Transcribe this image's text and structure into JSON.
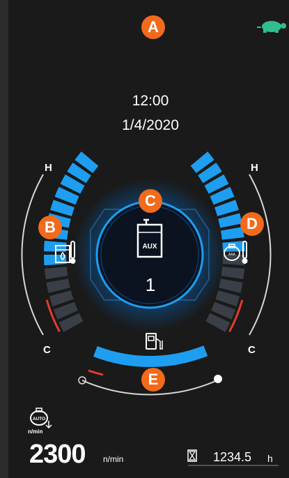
{
  "clock": {
    "time": "12:00",
    "date": "1/4/2020"
  },
  "badges": {
    "a": "A",
    "b": "B",
    "c": "C",
    "d": "D",
    "e": "E"
  },
  "left_gauge": {
    "hot_label": "H",
    "cold_label": "C",
    "level": 0.62,
    "icon": "coolant-temperature-icon"
  },
  "right_gauge": {
    "hot_label": "H",
    "cold_label": "C",
    "level": 0.6,
    "icon": "hydraulic-oil-temperature-icon"
  },
  "center": {
    "mode_label": "AUX",
    "mode_value": "1",
    "icon": "aux-tank-icon"
  },
  "fuel": {
    "level": 0.9,
    "icon": "fuel-pump-icon"
  },
  "engine_speed": {
    "icon_label": "AUTO",
    "icon_unit": "n/min",
    "value": "2300",
    "unit": "n/min"
  },
  "hour_meter": {
    "value": "1234.5",
    "unit": "h",
    "icon": "hourglass-icon"
  },
  "status": {
    "icon": "turtle-mode-icon"
  },
  "colors": {
    "accent": "#1e9ef0",
    "badge": "#f26a1b",
    "hot": "#e23c2c",
    "turtle": "#2fbf8c"
  }
}
